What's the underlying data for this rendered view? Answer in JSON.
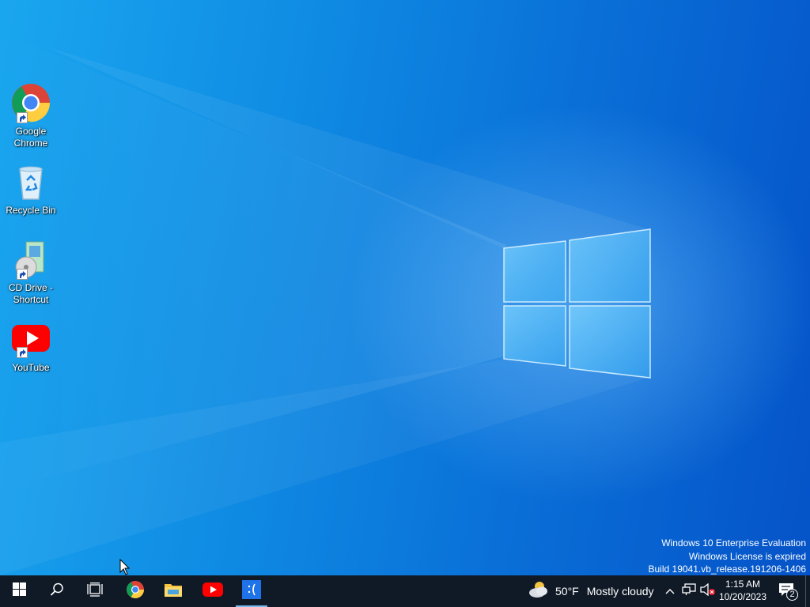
{
  "desktop": {
    "icons": [
      {
        "label": "Google Chrome",
        "icon": "chrome-icon"
      },
      {
        "label": "Recycle Bin",
        "icon": "recycle-bin-icon"
      },
      {
        "label": "CD Drive - Shortcut",
        "icon": "cd-drive-icon"
      },
      {
        "label": "YouTube",
        "icon": "youtube-icon"
      }
    ],
    "watermark": {
      "line1": "Windows 10 Enterprise Evaluation",
      "line2": "Windows License is expired",
      "line3": "Build 19041.vb_release.191206-1406"
    }
  },
  "taskbar": {
    "buttons": [
      {
        "name": "start-button",
        "icon": "windows-logo-icon"
      },
      {
        "name": "search-button",
        "icon": "search-icon"
      },
      {
        "name": "task-view-button",
        "icon": "task-view-icon"
      },
      {
        "name": "chrome-taskbar-button",
        "icon": "chrome-icon"
      },
      {
        "name": "file-explorer-button",
        "icon": "folder-icon"
      },
      {
        "name": "youtube-taskbar-button",
        "icon": "youtube-icon"
      },
      {
        "name": "app-taskbar-button",
        "icon": "sad-face-icon"
      }
    ],
    "weather": {
      "temperature": "50°F",
      "condition": "Mostly cloudy"
    },
    "clock": {
      "time": "1:15 AM",
      "date": "10/20/2023"
    },
    "notifications": {
      "count": "2"
    }
  },
  "colors": {
    "taskbar": "#101a27",
    "wallpaper_left": "#1aa6ef",
    "wallpaper_right": "#0553c8",
    "youtube_red": "#ff0000",
    "active_indicator": "#76b9ed"
  }
}
